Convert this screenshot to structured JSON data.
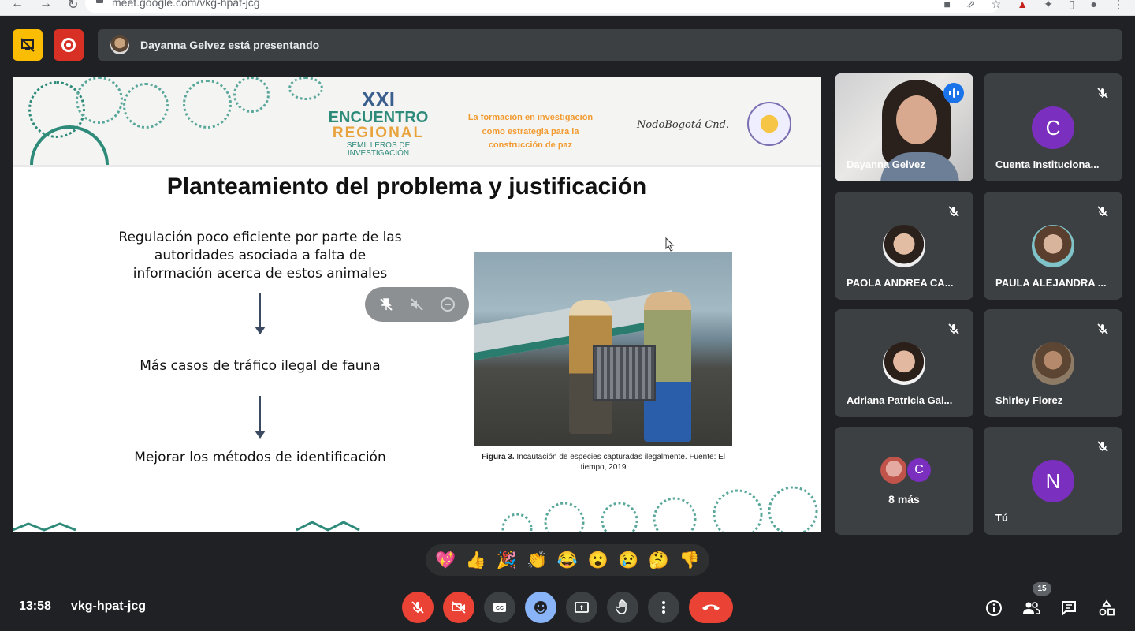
{
  "browser": {
    "url": "meet.google.com/vkg-hpat-jcg"
  },
  "top": {
    "presenting_text": "Dayanna Gelvez está presentando"
  },
  "slide": {
    "banner": {
      "edition": "XXI",
      "event_line1": "ENCUENTRO",
      "event_line2": "REGIONAL",
      "event_line3": "SEMILLEROS DE INVESTIGACIÓN",
      "tagline": "La formación en investigación como estrategia para la construcción de paz",
      "nodo": "NodoBogotá-Cnd."
    },
    "title": "Planteamiento del problema y justificación",
    "flow": [
      "Regulación poco eficiente por parte de las autoridades asociada a falta de información acerca de estos animales",
      "Más casos de tráfico ilegal de fauna",
      "Mejorar los métodos de identificación"
    ],
    "caption_bold": "Figura 3.",
    "caption_text": " Incautación de especies capturadas ilegalmente. Fuente: El tiempo, 2019"
  },
  "participants": [
    {
      "name": "Dayanna Gelvez",
      "speaking": true
    },
    {
      "name": "Cuenta Instituciona...",
      "initial": "C",
      "color": "#7b2fbe"
    },
    {
      "name": "PAOLA ANDREA CA..."
    },
    {
      "name": "PAULA ALEJANDRA ..."
    },
    {
      "name": "Adriana Patricia Gal..."
    },
    {
      "name": "Shirley Florez"
    },
    {
      "more_initial": "C",
      "more_label": "8 más"
    },
    {
      "name": "Tú",
      "initial": "N",
      "color": "#7b2fbe"
    }
  ],
  "reactions": [
    "💖",
    "👍",
    "🎉",
    "👏",
    "😂",
    "😮",
    "😢",
    "🤔",
    "👎"
  ],
  "bottom": {
    "time": "13:58",
    "meeting_code": "vkg-hpat-jcg",
    "participants_count": "15"
  },
  "colors": {
    "accent_blue": "#8ab4f8",
    "end_call_red": "#ea4335",
    "warning_yellow": "#fbbc04"
  }
}
